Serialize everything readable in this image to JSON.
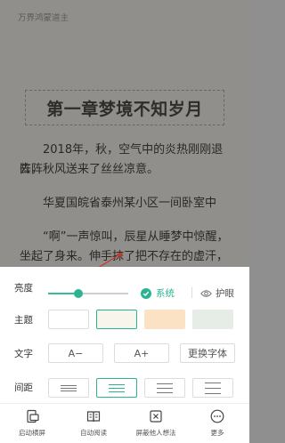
{
  "book": {
    "title": "万界鸿蒙道主"
  },
  "chapter": {
    "title": "第一章梦境不知岁月",
    "paragraphs": [
      "2018年，秋，空气中的炎热刚刚退去，",
      "阵阵秋风送来了丝丝凉意。",
      "华夏国皖省泰州某小区一间卧室中",
      "“啊”一声惊叫，辰星从睡梦中惊醒，",
      "坐起了身来。伸手抹了把不存在的虚汗，"
    ]
  },
  "settings": {
    "brightness": {
      "label": "亮度",
      "level": 0.38,
      "system_label": "系统",
      "system_checked": true,
      "eye_label": "护眼"
    },
    "theme": {
      "label": "主题",
      "swatches": [
        "#ffffff",
        "#f8f6ec",
        "#fbe2c4",
        "#e6ece6"
      ],
      "selected_index": 1
    },
    "text": {
      "label": "文字",
      "decrease_label": "A−",
      "increase_label": "A+",
      "font_label": "更换字体"
    },
    "spacing": {
      "label": "间距",
      "selected_index": 1
    }
  },
  "toolbar": [
    {
      "icon": "landscape-icon",
      "label": "启动横屏"
    },
    {
      "icon": "book-icon",
      "label": "自动阅读"
    },
    {
      "icon": "block-icon",
      "label": "屏蔽他人想法"
    },
    {
      "icon": "more-icon",
      "label": "更多"
    }
  ],
  "colors": {
    "accent": "#2cb392",
    "reader_bg": "#918f8c"
  }
}
